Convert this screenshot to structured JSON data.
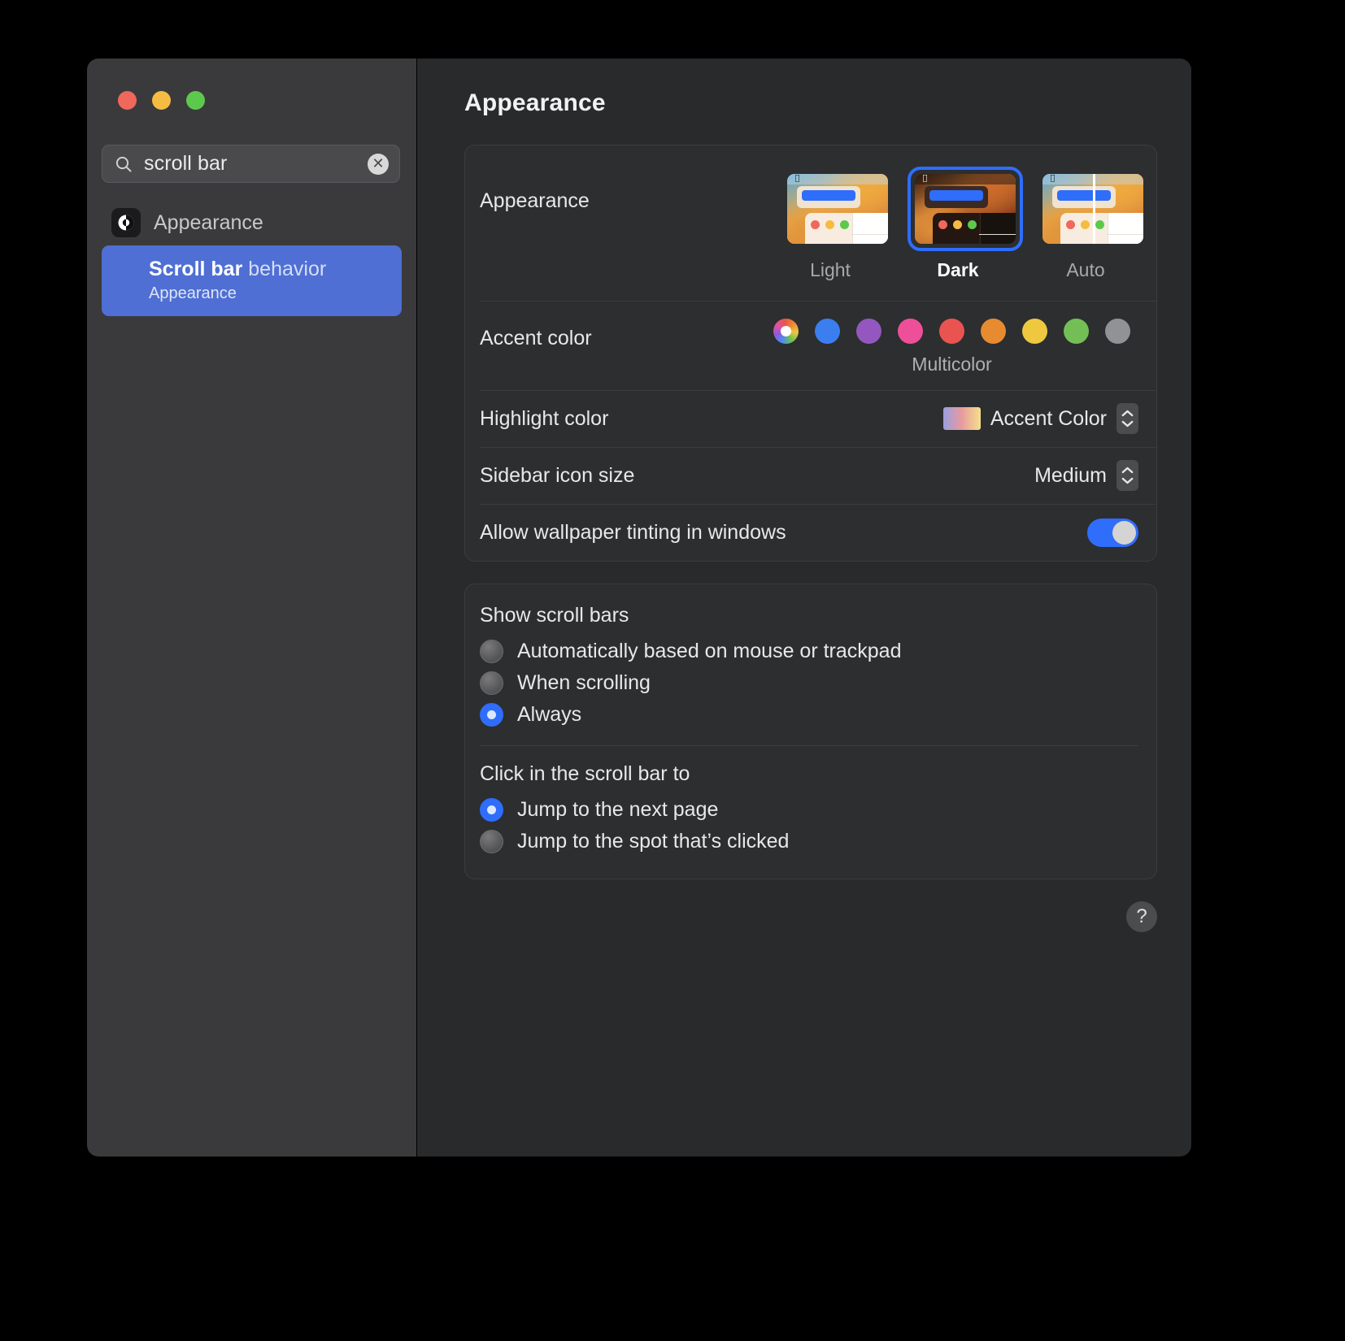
{
  "window": {
    "traffic_lights": [
      "close",
      "minimize",
      "zoom"
    ],
    "colors": {
      "close": "#f0675c",
      "minimize": "#f5bc41",
      "zoom": "#5dc94c",
      "accent_blue": "#2f6dfb"
    }
  },
  "sidebar": {
    "search": {
      "value": "scroll bar",
      "placeholder": "Search",
      "icon": "search-icon",
      "clear_icon": "clear-icon"
    },
    "results": [
      {
        "type": "header",
        "label": "Appearance",
        "icon": "appearance-app-icon"
      },
      {
        "type": "item",
        "title_bold": "Scroll bar",
        "title_rest": " behavior",
        "subtitle": "Appearance",
        "selected": true
      }
    ]
  },
  "main": {
    "title": "Appearance",
    "appearance": {
      "label": "Appearance",
      "options": [
        {
          "caption": "Light",
          "selected": false
        },
        {
          "caption": "Dark",
          "selected": true
        },
        {
          "caption": "Auto",
          "selected": false
        }
      ]
    },
    "accent": {
      "label": "Accent color",
      "caption": "Multicolor",
      "swatches": [
        {
          "name": "multicolor",
          "color": "multicolor",
          "selected": true
        },
        {
          "name": "blue",
          "color": "#3b7ef0"
        },
        {
          "name": "purple",
          "color": "#9357bf"
        },
        {
          "name": "pink",
          "color": "#ee4f99"
        },
        {
          "name": "red",
          "color": "#ea5450"
        },
        {
          "name": "orange",
          "color": "#e78b30"
        },
        {
          "name": "yellow",
          "color": "#eec93f"
        },
        {
          "name": "green",
          "color": "#73bf55"
        },
        {
          "name": "graphite",
          "color": "#909296"
        }
      ]
    },
    "highlight": {
      "label": "Highlight color",
      "value": "Accent Color"
    },
    "sidebar_icon_size": {
      "label": "Sidebar icon size",
      "value": "Medium"
    },
    "wallpaper_tinting": {
      "label": "Allow wallpaper tinting in windows",
      "enabled": true
    },
    "show_scroll_bars": {
      "title": "Show scroll bars",
      "options": [
        {
          "label": "Automatically based on mouse or trackpad",
          "selected": false
        },
        {
          "label": "When scrolling",
          "selected": false
        },
        {
          "label": "Always",
          "selected": true
        }
      ]
    },
    "click_scroll_bar": {
      "title": "Click in the scroll bar to",
      "options": [
        {
          "label": "Jump to the next page",
          "selected": true
        },
        {
          "label": "Jump to the spot that’s clicked",
          "selected": false
        }
      ]
    },
    "help_label": "?"
  }
}
